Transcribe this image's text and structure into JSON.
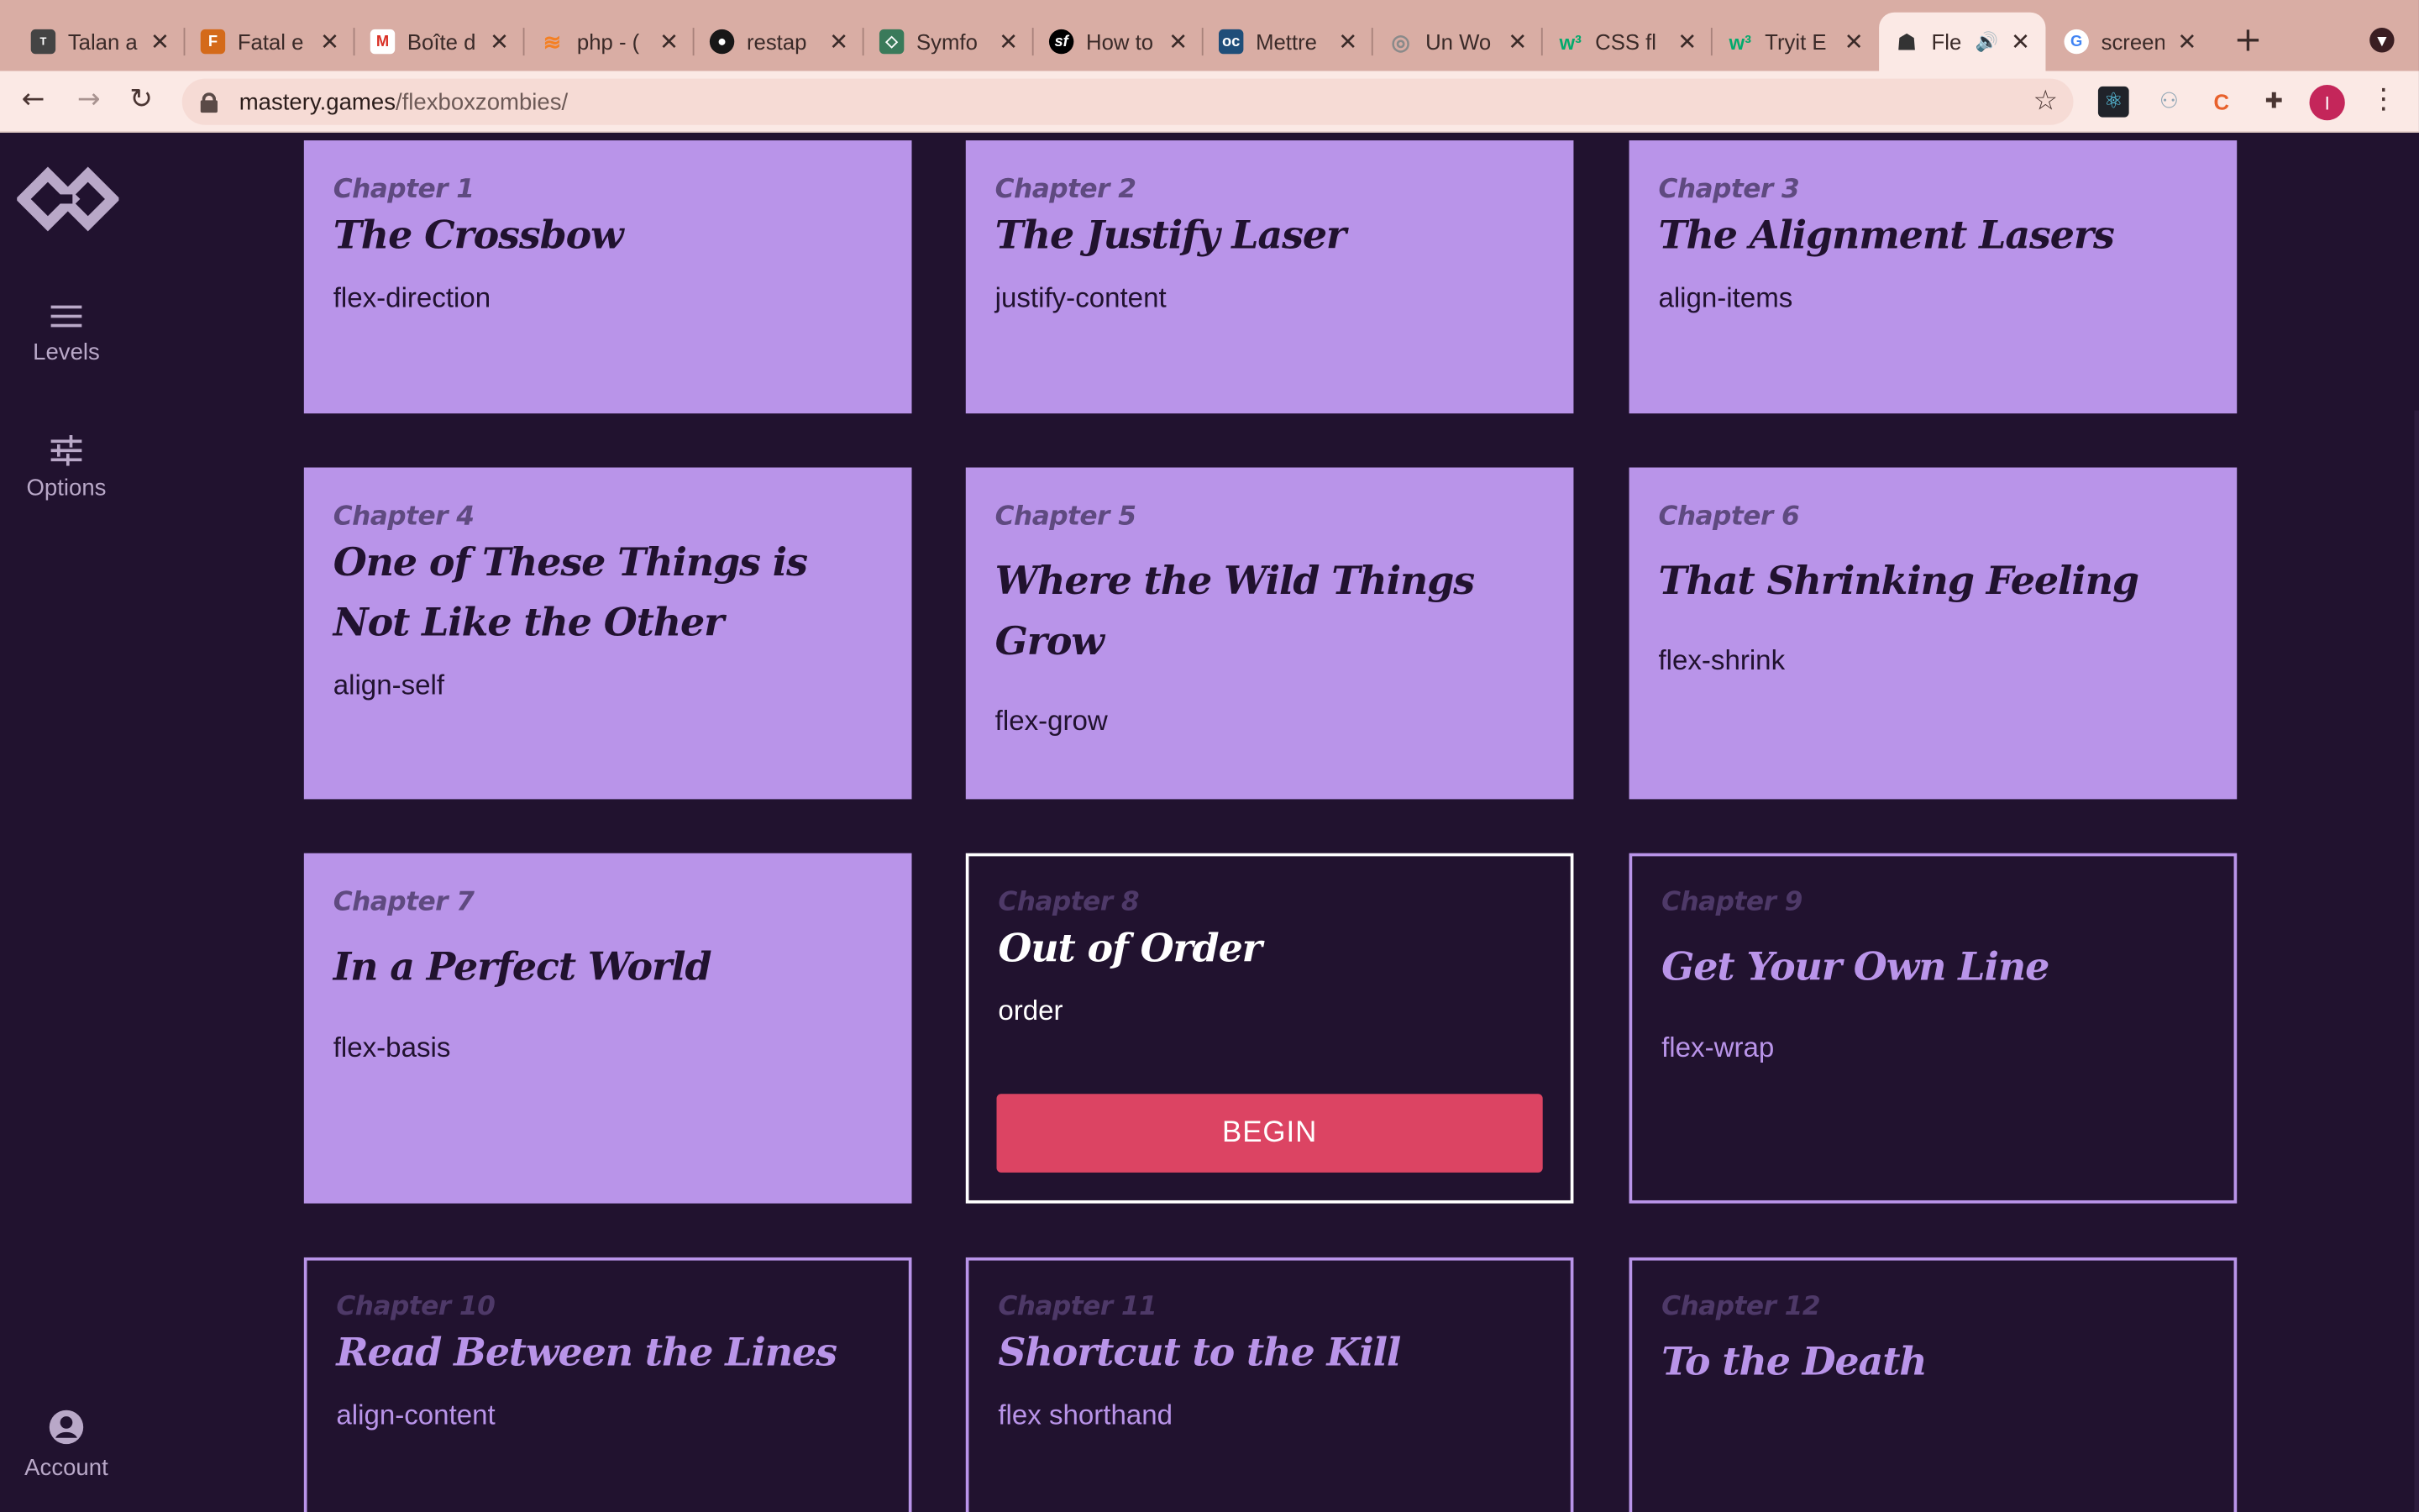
{
  "browser": {
    "tabs": [
      {
        "title": "Talan a",
        "icon": "talan-favicon",
        "color": "#444444"
      },
      {
        "title": "Fatal e",
        "icon": "fatal-favicon",
        "color": "#d46a1a"
      },
      {
        "title": "Boîte d",
        "icon": "gmail-favicon",
        "color": "#d93025"
      },
      {
        "title": "php - (",
        "icon": "stackoverflow-favicon",
        "color": "#f48024"
      },
      {
        "title": "restap",
        "icon": "github-favicon",
        "color": "#181717"
      },
      {
        "title": "Symfo",
        "icon": "symfonycasts-favicon",
        "color": "#3a7a5a"
      },
      {
        "title": "How to",
        "icon": "symfony-favicon",
        "color": "#000000"
      },
      {
        "title": "Mettre",
        "icon": "openclassrooms-favicon",
        "color": "#1f4e79"
      },
      {
        "title": "Un Wo",
        "icon": "wordpress-favicon",
        "color": "#8a8a8a"
      },
      {
        "title": "CSS fl",
        "icon": "w3schools-favicon",
        "color": "#04aa6d"
      },
      {
        "title": "Tryit E",
        "icon": "w3schools-favicon",
        "color": "#04aa6d"
      },
      {
        "title": "Fle",
        "icon": "flexbox-zombies-favicon",
        "color": "#333333",
        "active": true,
        "muted_icon": "speaker-icon"
      },
      {
        "title": "screen",
        "icon": "google-favicon",
        "color": "#4285f4"
      }
    ],
    "url_host": "mastery.games",
    "url_path": "/flexboxzombies/",
    "avatar_letter": "I"
  },
  "sidebar": {
    "levels_label": "Levels",
    "options_label": "Options",
    "account_label": "Account"
  },
  "chapters": [
    {
      "chapter": "Chapter 1",
      "title": "The Crossbow",
      "property": "flex-direction",
      "state": "done"
    },
    {
      "chapter": "Chapter 2",
      "title": "The Justify Laser",
      "property": "justify-content",
      "state": "done"
    },
    {
      "chapter": "Chapter 3",
      "title": "The Alignment Lasers",
      "property": "align-items",
      "state": "done"
    },
    {
      "chapter": "Chapter 4",
      "title": "One of These Things is Not Like the Other",
      "property": "align-self",
      "state": "done"
    },
    {
      "chapter": "Chapter 5",
      "title": "Where the Wild Things Grow",
      "property": "flex-grow",
      "state": "done"
    },
    {
      "chapter": "Chapter 6",
      "title": "That Shrinking Feeling",
      "property": "flex-shrink",
      "state": "done"
    },
    {
      "chapter": "Chapter 7",
      "title": "In a Perfect World",
      "property": "flex-basis",
      "state": "done"
    },
    {
      "chapter": "Chapter 8",
      "title": "Out of Order",
      "property": "order",
      "state": "current",
      "button": "BEGIN"
    },
    {
      "chapter": "Chapter 9",
      "title": "Get Your Own Line",
      "property": "flex-wrap",
      "state": "locked"
    },
    {
      "chapter": "Chapter 10",
      "title": "Read Between the Lines",
      "property": "align-content",
      "state": "locked"
    },
    {
      "chapter": "Chapter 11",
      "title": "Shortcut to the Kill",
      "property": "flex shorthand",
      "state": "locked"
    },
    {
      "chapter": "Chapter 12",
      "title": "To the Death",
      "property": "",
      "state": "locked"
    }
  ],
  "colors": {
    "background": "#21122f",
    "card_done": "#b994e9",
    "begin_button": "#dc4463",
    "chrome_tabstrip": "#d9ada4",
    "chrome_toolbar": "#fbe9e5"
  }
}
